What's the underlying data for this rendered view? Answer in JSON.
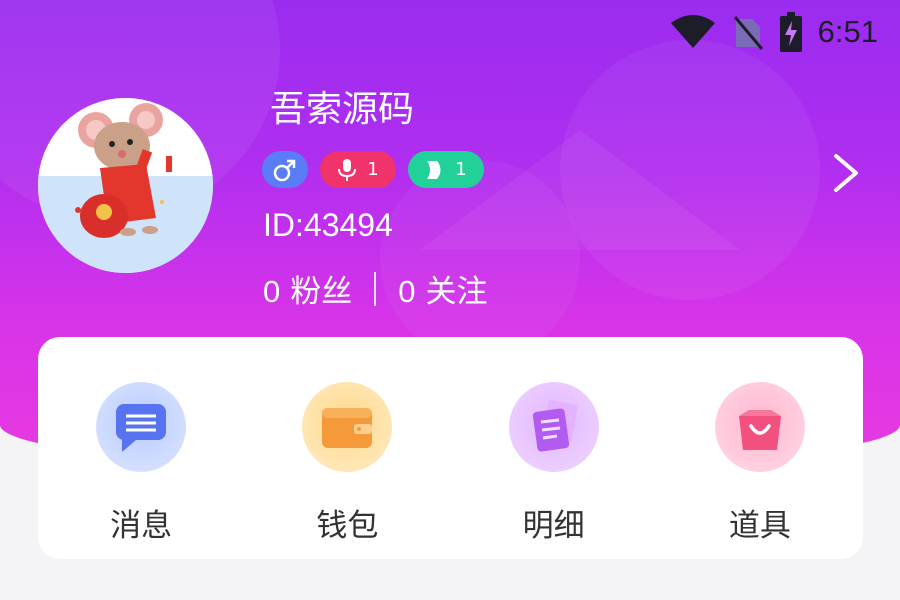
{
  "status_bar": {
    "time": "6:51",
    "icons": [
      "wifi-icon",
      "no-sim-icon",
      "battery-charging-icon"
    ]
  },
  "profile": {
    "username": "吾索源码",
    "badges": [
      {
        "icon": "male-icon",
        "value": "",
        "color": "#5b7cf7"
      },
      {
        "icon": "microphone-icon",
        "value": "1",
        "color": "#f0336a"
      },
      {
        "icon": "level-icon",
        "value": "1",
        "color": "#21d199"
      }
    ],
    "user_id": "ID:43494",
    "fans_count": "0",
    "fans_label": "粉丝",
    "following_count": "0",
    "following_label": "关注"
  },
  "menu": [
    {
      "label": "消息",
      "icon": "message-icon"
    },
    {
      "label": "钱包",
      "icon": "wallet-icon"
    },
    {
      "label": "明细",
      "icon": "details-icon"
    },
    {
      "label": "道具",
      "icon": "shopping-bag-icon"
    }
  ],
  "colors": {
    "header_top": "#9a2cf0",
    "header_bottom": "#e83ae0",
    "card_bg": "#ffffff"
  }
}
